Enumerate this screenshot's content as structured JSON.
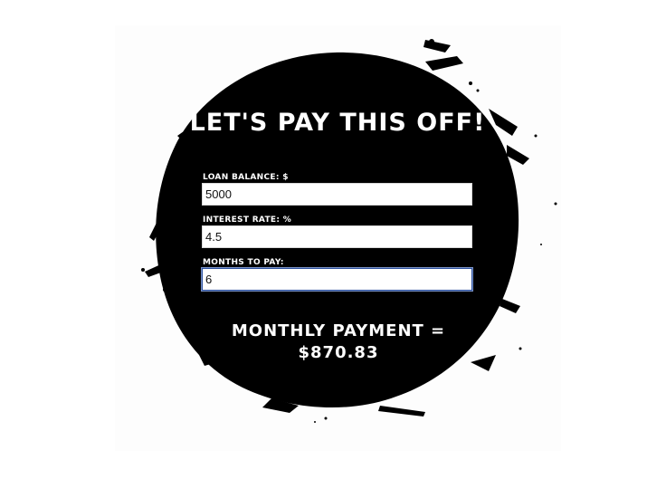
{
  "header": {
    "title": "LET'S PAY THIS OFF!"
  },
  "form": {
    "fields": [
      {
        "label": "LOAN BALANCE: $",
        "value": "5000"
      },
      {
        "label": "INTEREST RATE: %",
        "value": "4.5"
      },
      {
        "label": "MONTHS TO PAY:",
        "value": "6"
      }
    ]
  },
  "result": {
    "label": "MONTHLY PAYMENT =",
    "amount": "$870.83"
  },
  "colors": {
    "ink_circle": "#000000",
    "text": "#ffffff",
    "input_background": "#ffffff",
    "focus_border": "#2b4f9e"
  }
}
